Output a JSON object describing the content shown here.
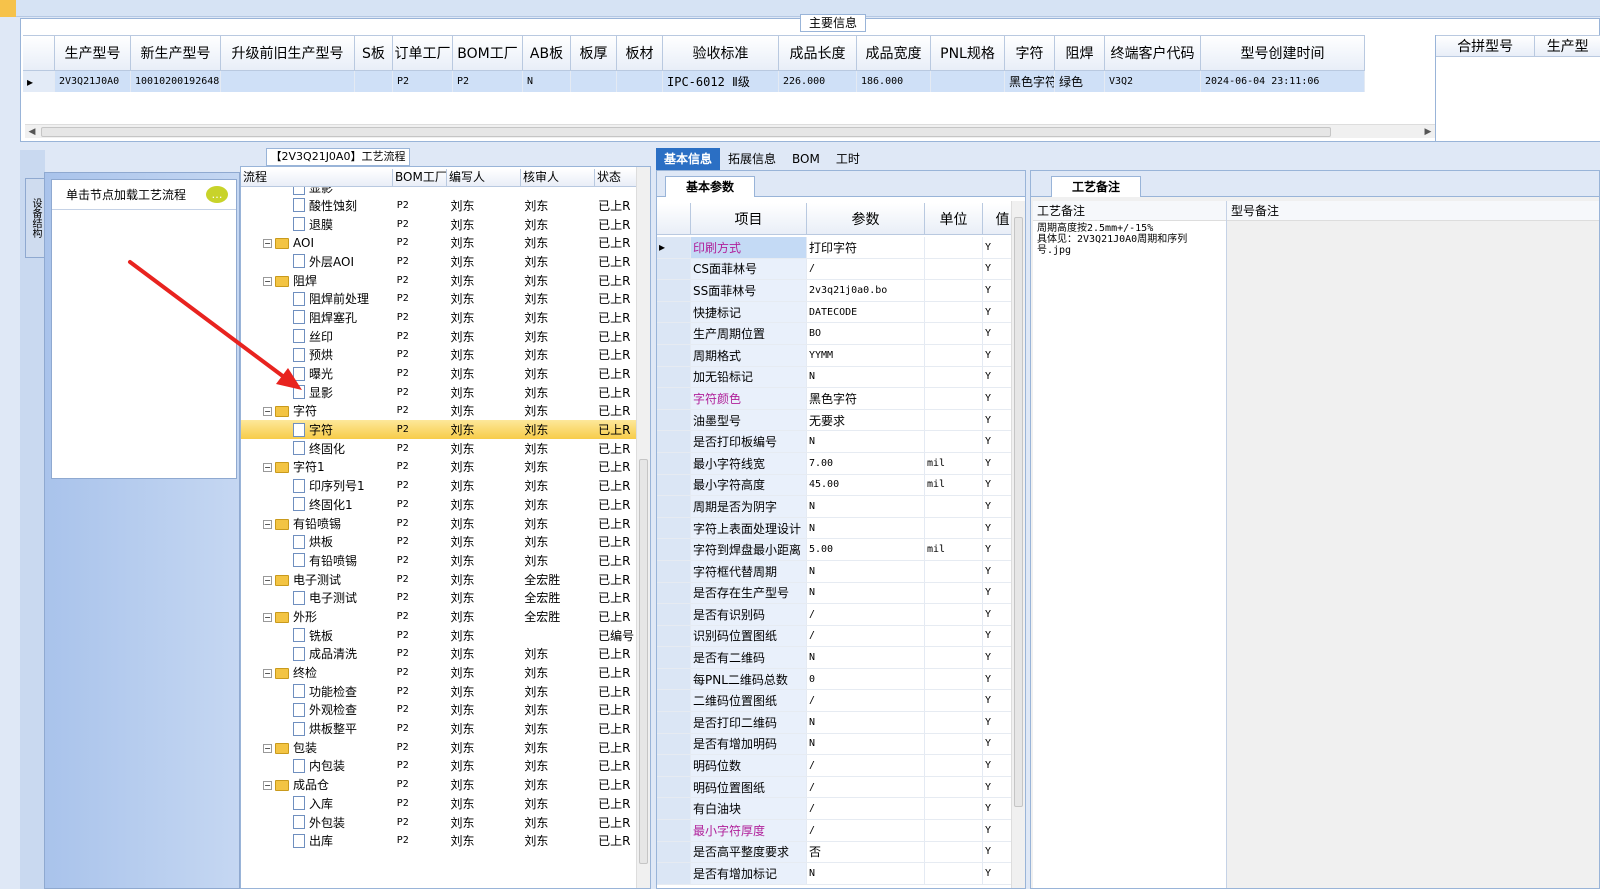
{
  "main": {
    "legend": "主要信息",
    "columns": [
      "生产型号",
      "新生产型号",
      "升级前旧生产型号",
      "S板",
      "订单工厂",
      "BOM工厂",
      "AB板",
      "板厚",
      "板材",
      "验收标准",
      "成品长度",
      "成品宽度",
      "PNL规格",
      "字符",
      "阻焊",
      "终端客户代码",
      "型号创建时间"
    ],
    "row": [
      "2V3Q21J0A0",
      "10010200192648",
      "",
      "",
      "P2",
      "P2",
      "N",
      "",
      "",
      "IPC-6012 Ⅱ级",
      "226.000",
      "186.000",
      "",
      "黑色字符",
      "绿色",
      "V3Q2",
      "2024-06-04 23:11:06"
    ],
    "merge_columns": [
      "合拼型号",
      "生产型"
    ]
  },
  "left": {
    "side_tab": "设备结构",
    "node_hint": "单击节点加载工艺流程"
  },
  "flow": {
    "legend": "【2V3Q21J0A0】工艺流程",
    "columns": [
      "流程",
      "BOM工厂",
      "编写人",
      "核审人",
      "状态"
    ],
    "rows": [
      {
        "name": "显影",
        "level": 1,
        "type": "doc",
        "bom": "",
        "writer": "",
        "reviewer": "",
        "status": ""
      },
      {
        "name": "酸性蚀刻",
        "level": 1,
        "type": "doc",
        "bom": "P2",
        "writer": "刘东",
        "reviewer": "刘东",
        "status": "已上R"
      },
      {
        "name": "退膜",
        "level": 1,
        "type": "doc",
        "bom": "P2",
        "writer": "刘东",
        "reviewer": "刘东",
        "status": "已上R"
      },
      {
        "name": "AOI",
        "level": 0,
        "type": "folder",
        "bom": "P2",
        "writer": "刘东",
        "reviewer": "刘东",
        "status": "已上R"
      },
      {
        "name": "外层AOI",
        "level": 1,
        "type": "doc",
        "bom": "P2",
        "writer": "刘东",
        "reviewer": "刘东",
        "status": "已上R"
      },
      {
        "name": "阻焊",
        "level": 0,
        "type": "folder",
        "bom": "P2",
        "writer": "刘东",
        "reviewer": "刘东",
        "status": "已上R"
      },
      {
        "name": "阻焊前处理",
        "level": 1,
        "type": "doc",
        "bom": "P2",
        "writer": "刘东",
        "reviewer": "刘东",
        "status": "已上R"
      },
      {
        "name": "阻焊塞孔",
        "level": 1,
        "type": "doc",
        "bom": "P2",
        "writer": "刘东",
        "reviewer": "刘东",
        "status": "已上R"
      },
      {
        "name": "丝印",
        "level": 1,
        "type": "doc",
        "bom": "P2",
        "writer": "刘东",
        "reviewer": "刘东",
        "status": "已上R"
      },
      {
        "name": "预烘",
        "level": 1,
        "type": "doc",
        "bom": "P2",
        "writer": "刘东",
        "reviewer": "刘东",
        "status": "已上R"
      },
      {
        "name": "曝光",
        "level": 1,
        "type": "doc",
        "bom": "P2",
        "writer": "刘东",
        "reviewer": "刘东",
        "status": "已上R"
      },
      {
        "name": "显影",
        "level": 1,
        "type": "doc",
        "bom": "P2",
        "writer": "刘东",
        "reviewer": "刘东",
        "status": "已上R"
      },
      {
        "name": "字符",
        "level": 0,
        "type": "folder",
        "bom": "P2",
        "writer": "刘东",
        "reviewer": "刘东",
        "status": "已上R"
      },
      {
        "name": "字符",
        "level": 1,
        "type": "doc",
        "bom": "P2",
        "writer": "刘东",
        "reviewer": "刘东",
        "status": "已上R",
        "selected": true
      },
      {
        "name": "终固化",
        "level": 1,
        "type": "doc",
        "bom": "P2",
        "writer": "刘东",
        "reviewer": "刘东",
        "status": "已上R"
      },
      {
        "name": "字符1",
        "level": 0,
        "type": "folder",
        "bom": "P2",
        "writer": "刘东",
        "reviewer": "刘东",
        "status": "已上R"
      },
      {
        "name": "印序列号1",
        "level": 1,
        "type": "doc",
        "bom": "P2",
        "writer": "刘东",
        "reviewer": "刘东",
        "status": "已上R"
      },
      {
        "name": "终固化1",
        "level": 1,
        "type": "doc",
        "bom": "P2",
        "writer": "刘东",
        "reviewer": "刘东",
        "status": "已上R"
      },
      {
        "name": "有铅喷锡",
        "level": 0,
        "type": "folder",
        "bom": "P2",
        "writer": "刘东",
        "reviewer": "刘东",
        "status": "已上R"
      },
      {
        "name": "烘板",
        "level": 1,
        "type": "doc",
        "bom": "P2",
        "writer": "刘东",
        "reviewer": "刘东",
        "status": "已上R"
      },
      {
        "name": "有铅喷锡",
        "level": 1,
        "type": "doc",
        "bom": "P2",
        "writer": "刘东",
        "reviewer": "刘东",
        "status": "已上R"
      },
      {
        "name": "电子测试",
        "level": 0,
        "type": "folder",
        "bom": "P2",
        "writer": "刘东",
        "reviewer": "全宏胜",
        "status": "已上R"
      },
      {
        "name": "电子测试",
        "level": 1,
        "type": "doc",
        "bom": "P2",
        "writer": "刘东",
        "reviewer": "全宏胜",
        "status": "已上R"
      },
      {
        "name": "外形",
        "level": 0,
        "type": "folder",
        "bom": "P2",
        "writer": "刘东",
        "reviewer": "全宏胜",
        "status": "已上R"
      },
      {
        "name": "铣板",
        "level": 1,
        "type": "doc",
        "bom": "P2",
        "writer": "刘东",
        "reviewer": "",
        "status": "已编号"
      },
      {
        "name": "成品清洗",
        "level": 1,
        "type": "doc",
        "bom": "P2",
        "writer": "刘东",
        "reviewer": "刘东",
        "status": "已上R"
      },
      {
        "name": "终检",
        "level": 0,
        "type": "folder",
        "bom": "P2",
        "writer": "刘东",
        "reviewer": "刘东",
        "status": "已上R"
      },
      {
        "name": "功能检查",
        "level": 1,
        "type": "doc",
        "bom": "P2",
        "writer": "刘东",
        "reviewer": "刘东",
        "status": "已上R"
      },
      {
        "name": "外观检查",
        "level": 1,
        "type": "doc",
        "bom": "P2",
        "writer": "刘东",
        "reviewer": "刘东",
        "status": "已上R"
      },
      {
        "name": "烘板整平",
        "level": 1,
        "type": "doc",
        "bom": "P2",
        "writer": "刘东",
        "reviewer": "刘东",
        "status": "已上R"
      },
      {
        "name": "包装",
        "level": 0,
        "type": "folder",
        "bom": "P2",
        "writer": "刘东",
        "reviewer": "刘东",
        "status": "已上R"
      },
      {
        "name": "内包装",
        "level": 1,
        "type": "doc",
        "bom": "P2",
        "writer": "刘东",
        "reviewer": "刘东",
        "status": "已上R"
      },
      {
        "name": "成品仓",
        "level": 0,
        "type": "folder",
        "bom": "P2",
        "writer": "刘东",
        "reviewer": "刘东",
        "status": "已上R"
      },
      {
        "name": "入库",
        "level": 1,
        "type": "doc",
        "bom": "P2",
        "writer": "刘东",
        "reviewer": "刘东",
        "status": "已上R"
      },
      {
        "name": "外包装",
        "level": 1,
        "type": "doc",
        "bom": "P2",
        "writer": "刘东",
        "reviewer": "刘东",
        "status": "已上R"
      },
      {
        "name": "出库",
        "level": 1,
        "type": "doc",
        "bom": "P2",
        "writer": "刘东",
        "reviewer": "刘东",
        "status": "已上R"
      }
    ]
  },
  "tabs": [
    "基本信息",
    "拓展信息",
    "BOM",
    "工时"
  ],
  "basic": {
    "subtab": "基本参数",
    "columns": [
      "项目",
      "参数",
      "单位",
      "值"
    ],
    "rows": [
      {
        "item": "印刷方式",
        "value": "打印字符",
        "unit": "",
        "flag": "Y",
        "pink": true,
        "selected": true
      },
      {
        "item": "CS面菲林号",
        "value": "/",
        "unit": "",
        "flag": "Y"
      },
      {
        "item": "SS面菲林号",
        "value": "2v3q21j0a0.bo",
        "unit": "",
        "flag": "Y"
      },
      {
        "item": "快捷标记",
        "value": "DATECODE",
        "unit": "",
        "flag": "Y"
      },
      {
        "item": "生产周期位置",
        "value": "BO",
        "unit": "",
        "flag": "Y"
      },
      {
        "item": "周期格式",
        "value": "YYMM",
        "unit": "",
        "flag": "Y"
      },
      {
        "item": "加无铅标记",
        "value": "N",
        "unit": "",
        "flag": "Y"
      },
      {
        "item": "字符颜色",
        "value": "黑色字符",
        "unit": "",
        "flag": "Y",
        "pink": true
      },
      {
        "item": "油墨型号",
        "value": "无要求",
        "unit": "",
        "flag": "Y"
      },
      {
        "item": "是否打印板编号",
        "value": "N",
        "unit": "",
        "flag": "Y"
      },
      {
        "item": "最小字符线宽",
        "value": "7.00",
        "unit": "mil",
        "flag": "Y"
      },
      {
        "item": "最小字符高度",
        "value": "45.00",
        "unit": "mil",
        "flag": "Y"
      },
      {
        "item": "周期是否为阴字",
        "value": "N",
        "unit": "",
        "flag": "Y"
      },
      {
        "item": "字符上表面处理设计",
        "value": "N",
        "unit": "",
        "flag": "Y"
      },
      {
        "item": "字符到焊盘最小距离",
        "value": "5.00",
        "unit": "mil",
        "flag": "Y"
      },
      {
        "item": "字符框代替周期",
        "value": "N",
        "unit": "",
        "flag": "Y"
      },
      {
        "item": "是否存在生产型号",
        "value": "N",
        "unit": "",
        "flag": "Y"
      },
      {
        "item": "是否有识别码",
        "value": "/",
        "unit": "",
        "flag": "Y"
      },
      {
        "item": "识别码位置图纸",
        "value": "/",
        "unit": "",
        "flag": "Y"
      },
      {
        "item": "是否有二维码",
        "value": "N",
        "unit": "",
        "flag": "Y"
      },
      {
        "item": "每PNL二维码总数",
        "value": "0",
        "unit": "",
        "flag": "Y"
      },
      {
        "item": "二维码位置图纸",
        "value": "/",
        "unit": "",
        "flag": "Y"
      },
      {
        "item": "是否打印二维码",
        "value": "N",
        "unit": "",
        "flag": "Y"
      },
      {
        "item": "是否有增加明码",
        "value": "N",
        "unit": "",
        "flag": "Y"
      },
      {
        "item": "明码位数",
        "value": "/",
        "unit": "",
        "flag": "Y"
      },
      {
        "item": "明码位置图纸",
        "value": "/",
        "unit": "",
        "flag": "Y"
      },
      {
        "item": "有白油块",
        "value": "/",
        "unit": "",
        "flag": "Y"
      },
      {
        "item": "最小字符厚度",
        "value": "/",
        "unit": "",
        "flag": "Y",
        "pink": true
      },
      {
        "item": "是否高平整度要求",
        "value": "否",
        "unit": "",
        "flag": "Y"
      },
      {
        "item": "是否有增加标记",
        "value": "N",
        "unit": "",
        "flag": "Y"
      }
    ]
  },
  "remarks": {
    "tab": "工艺备注",
    "craft_label": "工艺备注",
    "model_label": "型号备注",
    "craft_text": "周期高度按2.5mm+/-15%\n具体见：2V3Q21J0A0周期和序列号.jpg"
  }
}
